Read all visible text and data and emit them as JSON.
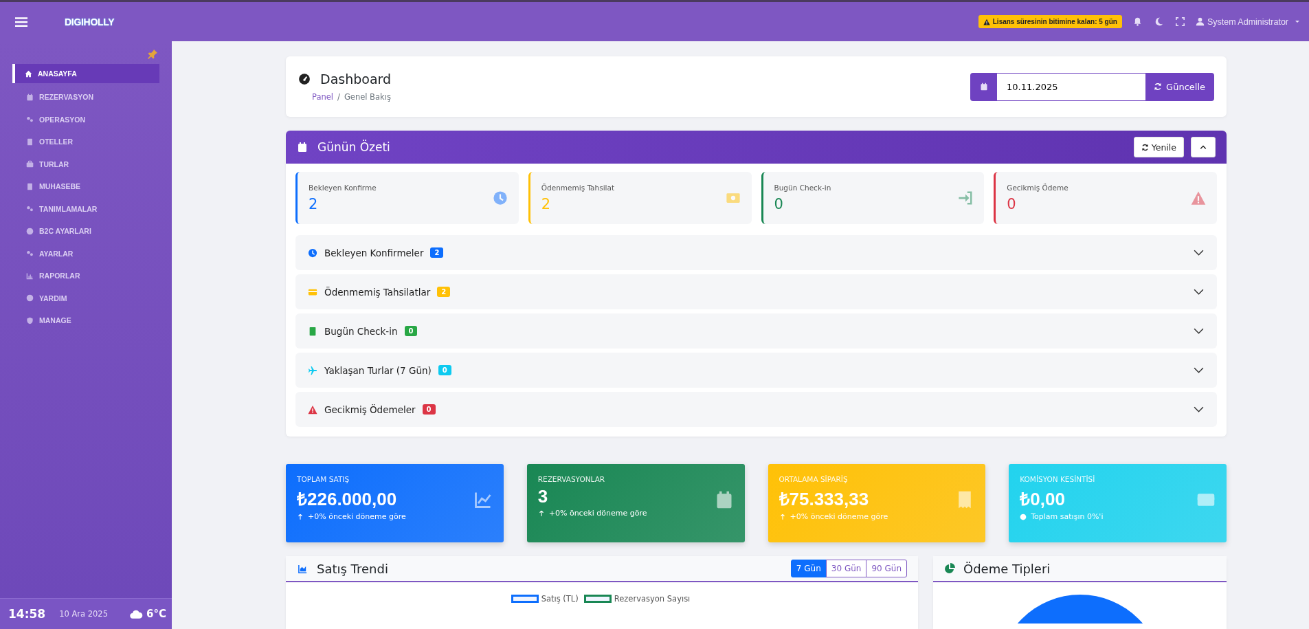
{
  "topbar": {
    "brand": "DIGIHOLLY",
    "license_notice": "Lisans süresinin bitimine kalan: 5 gün",
    "user_name": "System Administrator"
  },
  "sidebar": {
    "items": [
      {
        "label": "ANASAYFA",
        "selected": true
      },
      {
        "label": "REZERVASYON",
        "selected": false
      },
      {
        "label": "OPERASYON",
        "selected": false
      },
      {
        "label": "OTELLER",
        "selected": false
      },
      {
        "label": "TURLAR",
        "selected": false
      },
      {
        "label": "MUHASEBE",
        "selected": false
      },
      {
        "label": "TANIMLAMALAR",
        "selected": false
      },
      {
        "label": "B2C AYARLARI",
        "selected": false
      },
      {
        "label": "AYARLAR",
        "selected": false
      },
      {
        "label": "RAPORLAR",
        "selected": false
      },
      {
        "label": "YARDIM",
        "selected": false
      },
      {
        "label": "MANAGE",
        "selected": false
      }
    ],
    "clock": {
      "time": "14:58",
      "date": "10 Ara 2025",
      "temperature": "6°C"
    }
  },
  "header": {
    "title": "Dashboard",
    "breadcrumb": [
      "Panel",
      "Genel Bakış"
    ],
    "breadcrumb_separator": "/",
    "date_value": "10.11.2025",
    "update_button": "Güncelle"
  },
  "summary": {
    "title": "Günün Özeti",
    "refresh_button": "Yenile",
    "stats": [
      {
        "label": "Bekleyen Konfirme",
        "value": "2",
        "color": "#0d6efd"
      },
      {
        "label": "Ödenmemiş Tahsilat",
        "value": "2",
        "color": "#ffc107"
      },
      {
        "label": "Bugün Check-in",
        "value": "0",
        "color": "#198754"
      },
      {
        "label": "Gecikmiş Ödeme",
        "value": "0",
        "color": "#dc3545"
      }
    ],
    "sections": [
      {
        "title": "Bekleyen Konfirmeler",
        "count": "2",
        "color": "#0d6efd",
        "expanded": false
      },
      {
        "title": "Ödenmemiş Tahsilatlar",
        "count": "2",
        "color": "#ffc107",
        "expanded": false
      },
      {
        "title": "Bugün Check-in",
        "count": "0",
        "color": "#28a745",
        "expanded": false
      },
      {
        "title": "Yaklaşan Turlar (7 Gün)",
        "count": "0",
        "color": "#0dcaf0",
        "expanded": false
      },
      {
        "title": "Gecikmiş Ödemeler",
        "count": "0",
        "color": "#dc3545",
        "expanded": false
      }
    ]
  },
  "kpis": [
    {
      "label": "TOPLAM SATIŞ",
      "value": "₺226.000,00",
      "note": "+0% önceki döneme göre",
      "kind": "change",
      "color": "#0d6efd"
    },
    {
      "label": "REZERVASYONLAR",
      "value": "3",
      "note": "+0% önceki döneme göre",
      "kind": "change",
      "color": "#198754"
    },
    {
      "label": "ORTALAMA SİPARİŞ",
      "value": "₺75.333,33",
      "note": "+0% önceki döneme göre",
      "kind": "change",
      "color": "#ffc107"
    },
    {
      "label": "KOMİSYON KESİNTİSİ",
      "value": "₺0,00",
      "note": "Toplam satışın 0%'i",
      "kind": "info",
      "color": "#22d3ee"
    }
  ],
  "sales_trend": {
    "title": "Satış Trendi",
    "ranges": [
      {
        "label": "7 Gün",
        "selected": true
      },
      {
        "label": "30 Gün",
        "selected": false
      },
      {
        "label": "90 Gün",
        "selected": false
      }
    ],
    "legend": [
      {
        "label": "Satış (TL)",
        "color": "#0d6efd"
      },
      {
        "label": "Rezervasyon Sayısı",
        "color": "#198754"
      }
    ]
  },
  "payment_types": {
    "title": "Ödeme Tipleri"
  }
}
